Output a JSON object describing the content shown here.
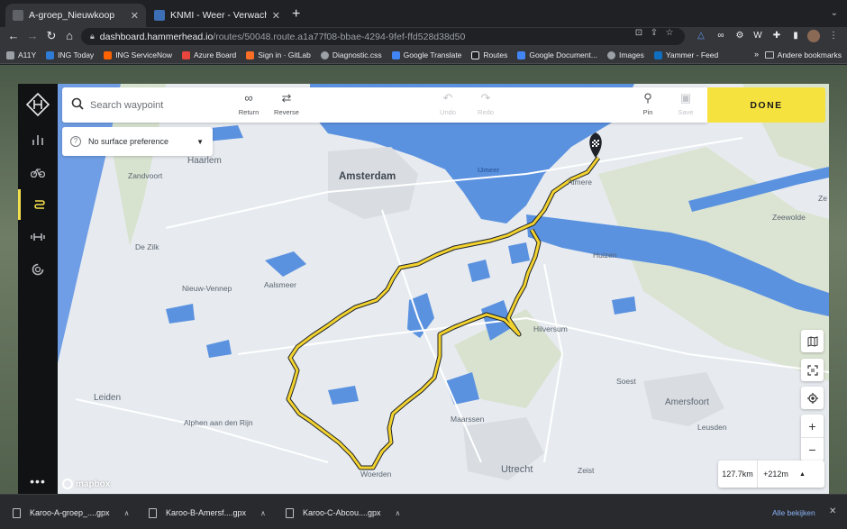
{
  "browser": {
    "tabs": [
      {
        "title": "A-groep_Nieuwkoop",
        "active": true
      },
      {
        "title": "KNMI - Weer - Verwachtingen",
        "active": false
      }
    ],
    "new_tab": "+",
    "url_host": "dashboard.hammerhead.io",
    "url_path": "/routes/50048.route.a1a77f08-bbae-4294-9fef-ffd528d38d50",
    "bookmarks": [
      {
        "label": "A11Y",
        "color": "#9aa0a6"
      },
      {
        "label": "ING Today",
        "color": "#2e7cd6"
      },
      {
        "label": "ING ServiceNow",
        "color": "#ff6200"
      },
      {
        "label": "Azure Board",
        "color": "#e8453c"
      },
      {
        "label": "Sign in · GitLab",
        "color": "#fc6d26"
      },
      {
        "label": "Diagnostic.css",
        "color": "#9aa0a6"
      },
      {
        "label": "Google Translate",
        "color": "#4285f4"
      },
      {
        "label": "Routes",
        "color": "#e8eaed"
      },
      {
        "label": "Google Document...",
        "color": "#4285f4"
      },
      {
        "label": "Images",
        "color": "#9aa0a6"
      },
      {
        "label": "Yammer - Feed",
        "color": "#106ebe"
      }
    ],
    "bookmarks_more": "»",
    "other_bookmarks": "Andere bookmarks"
  },
  "app": {
    "search": {
      "placeholder": "Search waypoint"
    },
    "tools": {
      "return": "Return",
      "reverse": "Reverse",
      "undo": "Undo",
      "redo": "Redo",
      "pin": "Pin",
      "save": "Save"
    },
    "done": "DONE",
    "surface": "No surface preference",
    "stats": {
      "distance": "127.7km",
      "elevation": "+212m"
    },
    "mapbox": "mapbox"
  },
  "map_labels": {
    "amsterdam": "Amsterdam",
    "haarlem": "Haarlem",
    "zandvoort": "Zandvoort",
    "almere": "Almere",
    "ijmeer": "IJmeer",
    "zeewolde": "Zeewolde",
    "huizen": "Huizen",
    "de_zilk": "De Zilk",
    "nieuw_vennep": "Nieuw-Vennep",
    "aalsmeer": "Aalsmeer",
    "hilversum": "Hilversum",
    "leiden": "Leiden",
    "alphen": "Alphen aan den Rijn",
    "soest": "Soest",
    "amersfoort": "Amersfoort",
    "leusden": "Leusden",
    "maarssen": "Maarssen",
    "utrecht": "Utrecht",
    "zeist": "Zeist",
    "woerden": "Woerden",
    "zee_edge": "Ze"
  },
  "downloads": {
    "items": [
      "Karoo-A-groep_....gpx",
      "Karoo-B-Amersf....gpx",
      "Karoo-C-Abcou....gpx"
    ],
    "show_all": "Alle bekijken",
    "close": "✕"
  },
  "colors": {
    "done_yellow": "#f6e23f",
    "route_yellow": "#f2d22e",
    "water_blue": "#5b92e0",
    "sidebar": "#111214"
  }
}
